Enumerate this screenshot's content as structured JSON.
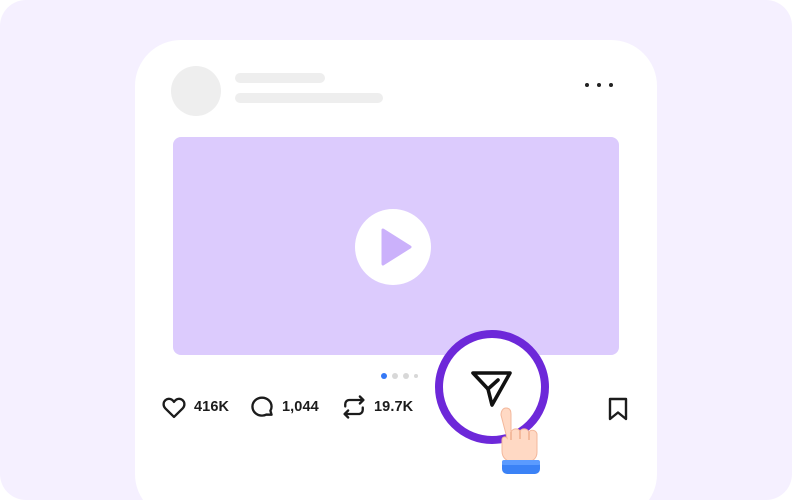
{
  "post": {
    "actions": [
      {
        "id": "like",
        "icon": "heart-icon",
        "count": "416K"
      },
      {
        "id": "comment",
        "icon": "comment-bubble-icon",
        "count": "1,044"
      },
      {
        "id": "repost",
        "icon": "repost-icon",
        "count": "19.7K"
      }
    ],
    "share_icon": "send-icon",
    "bookmark_icon": "bookmark-icon",
    "more_icon": "more-horizontal-icon",
    "media_icon": "play-icon",
    "carousel": {
      "total": 4,
      "active_index": 0
    }
  },
  "colors": {
    "background": "#f5f0ff",
    "card": "#ffffff",
    "media": "#dccbfd",
    "play_triangle": "#cbb1fb",
    "highlight_ring": "#6d28d9",
    "carousel_active": "#3478f6",
    "skeleton": "#eeeeee",
    "text": "#1c1c1c"
  }
}
